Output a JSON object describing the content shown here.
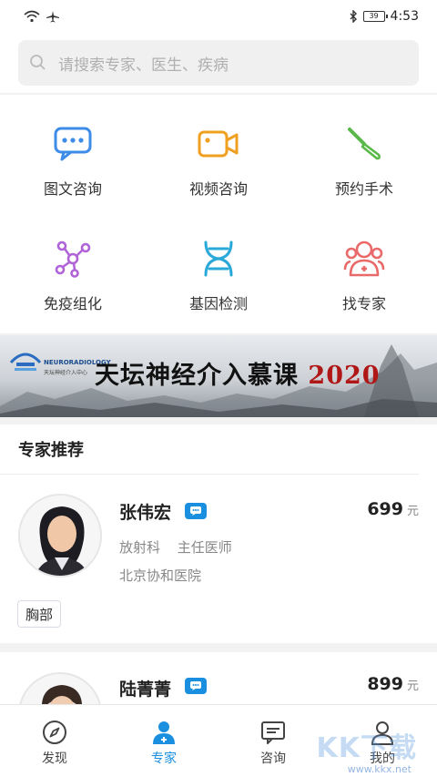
{
  "status_bar": {
    "time": "4:53",
    "battery": "39"
  },
  "search": {
    "placeholder": "请搜索专家、医生、疾病"
  },
  "services": [
    {
      "label": "图文咨询",
      "icon": "chat-bubble-icon"
    },
    {
      "label": "视频咨询",
      "icon": "video-camera-icon"
    },
    {
      "label": "预约手术",
      "icon": "scalpel-icon"
    },
    {
      "label": "免疫组化",
      "icon": "molecule-icon"
    },
    {
      "label": "基因检测",
      "icon": "dna-icon"
    },
    {
      "label": "找专家",
      "icon": "doctor-group-icon"
    }
  ],
  "banner": {
    "title": "天坛神经介入慕课",
    "year": "2020",
    "logo_text": "NEURORADIOLOGY",
    "logo_sub": "天坛神经介入中心"
  },
  "recommend": {
    "title": "专家推荐"
  },
  "doctors": [
    {
      "name": "张伟宏",
      "price": "699",
      "unit": "元",
      "department": "放射科",
      "title": "主任医师",
      "hospital": "北京协和医院",
      "tag": "胸部"
    },
    {
      "name": "陆菁菁",
      "price": "899",
      "unit": "元"
    }
  ],
  "tabbar": [
    {
      "label": "发现",
      "icon": "compass-icon"
    },
    {
      "label": "专家",
      "icon": "doctor-icon",
      "active": true
    },
    {
      "label": "咨询",
      "icon": "message-icon"
    },
    {
      "label": "我的",
      "icon": "user-icon"
    }
  ],
  "watermark": {
    "text": "KK下载",
    "url": "www.kkx.net"
  },
  "colors": {
    "accent": "#1a8fe0",
    "chat_icon": "#3d8de8",
    "video_icon": "#f0a020",
    "scalpel_icon": "#58b848",
    "molecule_icon": "#b064d8",
    "dna_icon": "#2aa8d8",
    "group_icon": "#e86a6a"
  }
}
